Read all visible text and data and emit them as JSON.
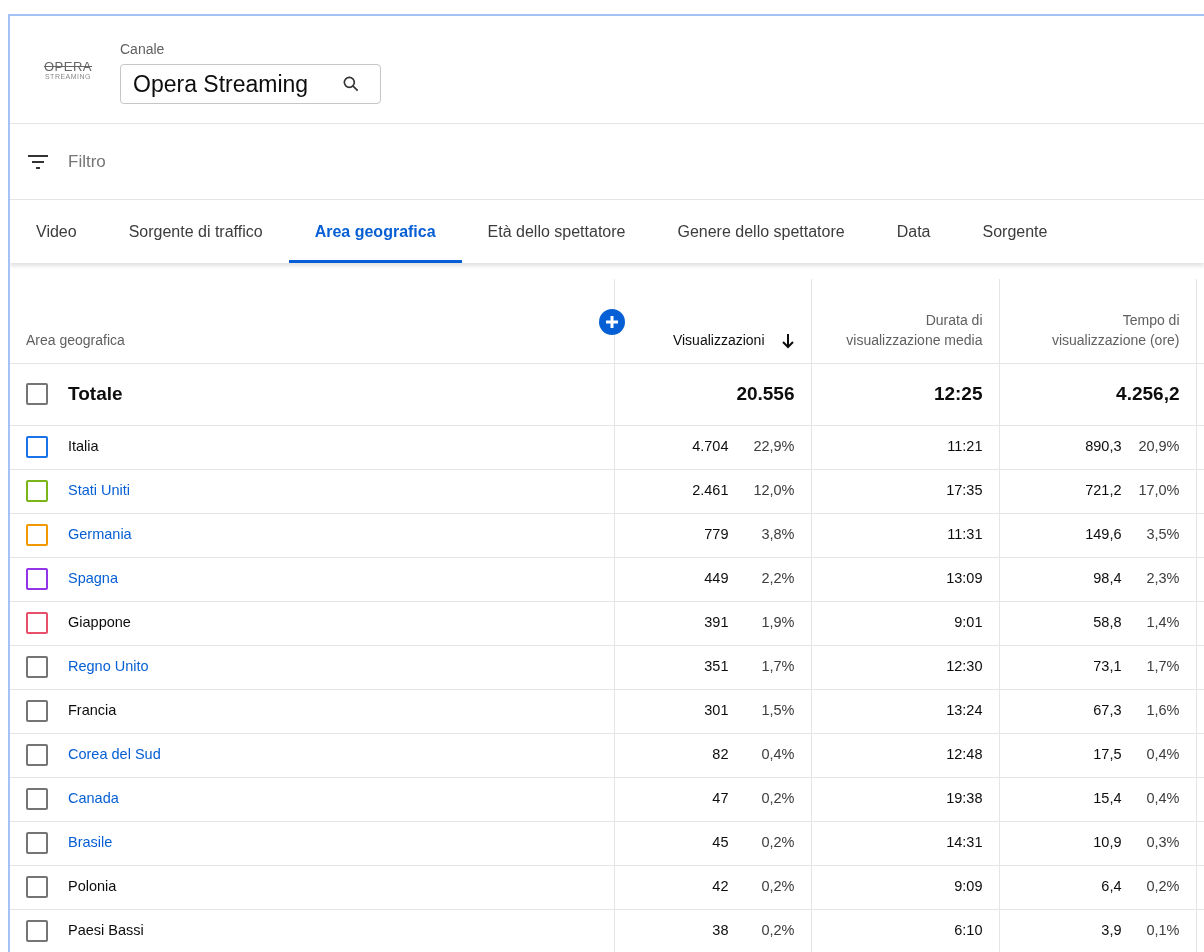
{
  "channel": {
    "logo_word": "OPERA",
    "logo_sub": "STREAMING",
    "label": "Canale",
    "value": "Opera Streaming"
  },
  "filter": {
    "placeholder": "Filtro"
  },
  "tabs": [
    {
      "label": "Video",
      "selected": false
    },
    {
      "label": "Sorgente di traffico",
      "selected": false
    },
    {
      "label": "Area geografica",
      "selected": true
    },
    {
      "label": "Età dello spettatore",
      "selected": false
    },
    {
      "label": "Genere dello spettatore",
      "selected": false
    },
    {
      "label": "Data",
      "selected": false
    },
    {
      "label": "Sorgente",
      "selected": false
    }
  ],
  "table": {
    "columns": [
      {
        "label": "Area geografica"
      },
      {
        "label": "Visualizzazioni",
        "sorted": true
      },
      {
        "label": "Durata di visualizzazione media",
        "sorted": false
      },
      {
        "label": "Tempo di visualizzazione (ore)",
        "sorted": false
      }
    ],
    "total": {
      "label": "Totale",
      "checked": false,
      "views": "20.556",
      "duration": "12:25",
      "hours": "4.256,2"
    },
    "rows": [
      {
        "name": "Italia",
        "link": false,
        "checked": false,
        "color": "#1a73e8",
        "views": "4.704",
        "views_pct": "22,9%",
        "duration": "11:21",
        "hours": "890,3",
        "hours_pct": "20,9%"
      },
      {
        "name": "Stati Uniti",
        "link": true,
        "checked": false,
        "color": "#7cb518",
        "views": "2.461",
        "views_pct": "12,0%",
        "duration": "17:35",
        "hours": "721,2",
        "hours_pct": "17,0%"
      },
      {
        "name": "Germania",
        "link": true,
        "checked": false,
        "color": "#f29900",
        "views": "779",
        "views_pct": "3,8%",
        "duration": "11:31",
        "hours": "149,6",
        "hours_pct": "3,5%"
      },
      {
        "name": "Spagna",
        "link": true,
        "checked": false,
        "color": "#9334e6",
        "views": "449",
        "views_pct": "2,2%",
        "duration": "13:09",
        "hours": "98,4",
        "hours_pct": "2,3%"
      },
      {
        "name": "Giappone",
        "link": false,
        "checked": false,
        "color": "#e8506a",
        "views": "391",
        "views_pct": "1,9%",
        "duration": "9:01",
        "hours": "58,8",
        "hours_pct": "1,4%"
      },
      {
        "name": "Regno Unito",
        "link": true,
        "checked": false,
        "color": "#757575",
        "views": "351",
        "views_pct": "1,7%",
        "duration": "12:30",
        "hours": "73,1",
        "hours_pct": "1,7%"
      },
      {
        "name": "Francia",
        "link": false,
        "checked": false,
        "color": "#757575",
        "views": "301",
        "views_pct": "1,5%",
        "duration": "13:24",
        "hours": "67,3",
        "hours_pct": "1,6%"
      },
      {
        "name": "Corea del Sud",
        "link": true,
        "checked": false,
        "color": "#757575",
        "views": "82",
        "views_pct": "0,4%",
        "duration": "12:48",
        "hours": "17,5",
        "hours_pct": "0,4%"
      },
      {
        "name": "Canada",
        "link": true,
        "checked": false,
        "color": "#757575",
        "views": "47",
        "views_pct": "0,2%",
        "duration": "19:38",
        "hours": "15,4",
        "hours_pct": "0,4%"
      },
      {
        "name": "Brasile",
        "link": true,
        "checked": false,
        "color": "#757575",
        "views": "45",
        "views_pct": "0,2%",
        "duration": "14:31",
        "hours": "10,9",
        "hours_pct": "0,3%"
      },
      {
        "name": "Polonia",
        "link": false,
        "checked": false,
        "color": "#757575",
        "views": "42",
        "views_pct": "0,2%",
        "duration": "9:09",
        "hours": "6,4",
        "hours_pct": "0,2%"
      },
      {
        "name": "Paesi Bassi",
        "link": false,
        "checked": false,
        "color": "#757575",
        "views": "38",
        "views_pct": "0,2%",
        "duration": "6:10",
        "hours": "3,9",
        "hours_pct": "0,1%"
      }
    ]
  }
}
